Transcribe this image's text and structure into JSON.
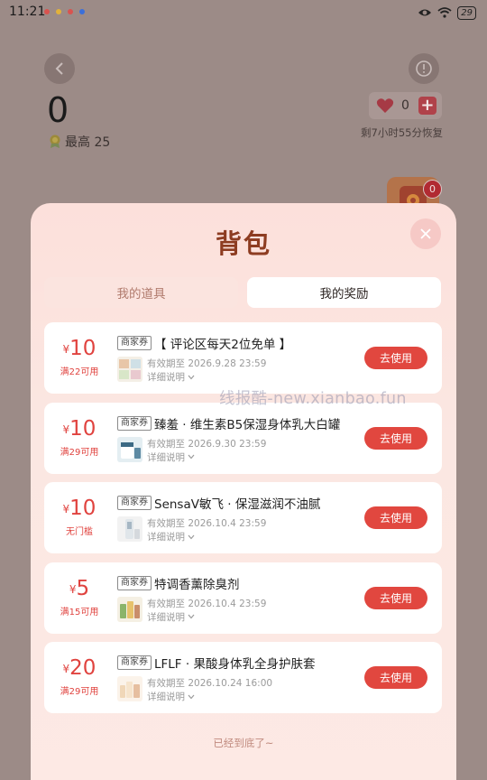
{
  "status_bar": {
    "time": "11:21",
    "battery": "29",
    "notification_colors": [
      "#d9534f",
      "#e2b23b",
      "#d9534f",
      "#3b6fd9"
    ]
  },
  "game": {
    "score": "0",
    "best_label": "最高 25",
    "lives": "0",
    "recover_text": "剩7小时55分恢复",
    "bag_badge": "0"
  },
  "panel": {
    "title": "背包",
    "tabs": [
      {
        "label": "我的道具",
        "active": false
      },
      {
        "label": "我的奖励",
        "active": true
      }
    ],
    "coupons": [
      {
        "yen": "¥",
        "amount": "10",
        "condition": "满22可用",
        "tag": "商家券",
        "name": "【 评论区每天2位免单 】",
        "valid": "有效期至 2026.9.28 23:59",
        "detail": "详细说明",
        "button": "去使用"
      },
      {
        "yen": "¥",
        "amount": "10",
        "condition": "满29可用",
        "tag": "商家券",
        "name": "臻羞 · 维生素B5保湿身体乳大白罐",
        "valid": "有效期至 2026.9.30 23:59",
        "detail": "详细说明",
        "button": "去使用"
      },
      {
        "yen": "¥",
        "amount": "10",
        "condition": "无门槛",
        "tag": "商家券",
        "name": "SensaV敏飞 · 保湿滋润不油腻",
        "valid": "有效期至 2026.10.4 23:59",
        "detail": "详细说明",
        "button": "去使用"
      },
      {
        "yen": "¥",
        "amount": "5",
        "condition": "满15可用",
        "tag": "商家券",
        "name": "特调香薰除臭剂",
        "valid": "有效期至 2026.10.4 23:59",
        "detail": "详细说明",
        "button": "去使用"
      },
      {
        "yen": "¥",
        "amount": "20",
        "condition": "满29可用",
        "tag": "商家券",
        "name": "LFLF · 果酸身体乳全身护肤套",
        "valid": "有效期至 2026.10.24 16:00",
        "detail": "详细说明",
        "button": "去使用"
      }
    ],
    "end_text": "已经到底了~"
  },
  "watermark": "线报酷-new.xianbao.fun",
  "colors": {
    "accent_red": "#e1473f",
    "title_brown": "#8d3c21",
    "overlay": "#9c8b87"
  }
}
